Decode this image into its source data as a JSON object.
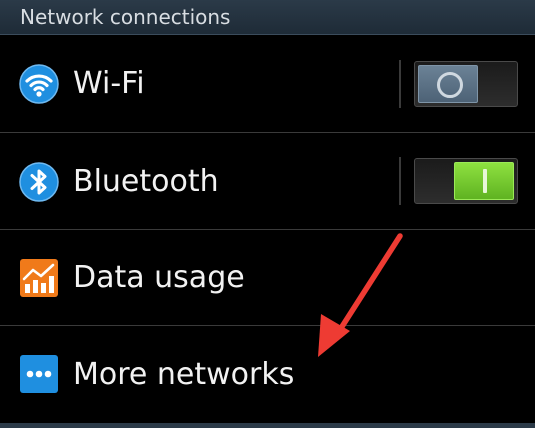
{
  "section": {
    "title": "Network connections"
  },
  "rows": [
    {
      "label": "Wi-Fi",
      "icon": "wifi-icon",
      "toggle": "off"
    },
    {
      "label": "Bluetooth",
      "icon": "bluetooth-icon",
      "toggle": "on"
    },
    {
      "label": "Data usage",
      "icon": "data-usage-icon"
    },
    {
      "label": "More networks",
      "icon": "more-networks-icon"
    }
  ],
  "colors": {
    "accent_on": "#6cc62a",
    "knob_off": "#5a7085",
    "icon_blue": "#1f8fe0",
    "data_usage_orange": "#f07a1a",
    "annotation_arrow": "#ee3b33"
  }
}
